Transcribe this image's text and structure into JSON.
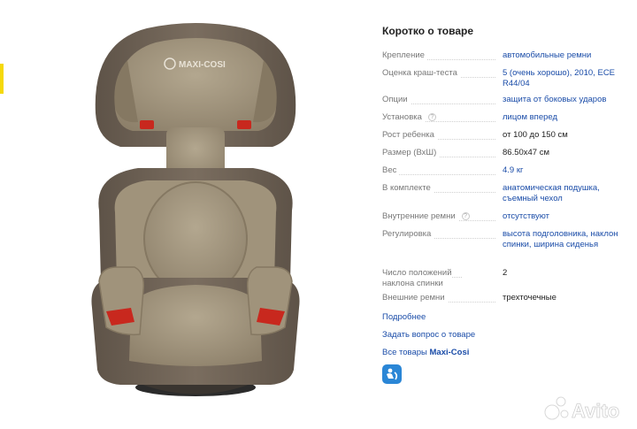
{
  "logo": {
    "text": "MAXI-COSI"
  },
  "watermark": {
    "text": "Avito"
  },
  "specs": {
    "title": "Коротко о товаре",
    "rows": [
      {
        "label": "Крепление",
        "value": "автомобильные ремни",
        "link": true,
        "help": false
      },
      {
        "label": "Оценка краш-теста",
        "value": "5 (очень хорошо), 2010, ECE R44/04",
        "link": true,
        "help": false
      },
      {
        "label": "Опции",
        "value": "защита от боковых ударов",
        "link": true,
        "help": false
      },
      {
        "label": "Установка",
        "value": "лицом вперед",
        "link": true,
        "help": true
      },
      {
        "label": "Рост ребенка",
        "value": "от 100 до 150 см",
        "link": false,
        "help": false
      },
      {
        "label": "Размер (ВхШ)",
        "value": "86.50x47 см",
        "link": false,
        "help": false
      },
      {
        "label": "Вес",
        "value": "4.9 кг",
        "link": true,
        "help": false
      },
      {
        "label": "В комплекте",
        "value": "анатомическая подушка, съемный чехол",
        "link": true,
        "help": false
      },
      {
        "label": "Внутренние ремни",
        "value": "отсутствуют",
        "link": true,
        "help": true
      },
      {
        "label": "Регулировка",
        "value": "высота подголовника, наклон спинки, ширина сиденья",
        "link": true,
        "help": false
      },
      {
        "label": "Число положений наклона спинки",
        "value": "2",
        "link": false,
        "help": false
      },
      {
        "label": "Внешние ремни",
        "value": "трехточечные",
        "link": false,
        "help": false
      }
    ]
  },
  "links": {
    "more": "Подробнее",
    "ask": "Задать вопрос о товаре",
    "all_prefix": "Все товары ",
    "all_brand": "Maxi-Cosi"
  },
  "colors": {
    "link": "#1a4ca8",
    "seat_fabric": "#9b8e76",
    "seat_dark": "#6b5f52",
    "accent_red": "#c8281e",
    "badge": "#2a86d6"
  }
}
